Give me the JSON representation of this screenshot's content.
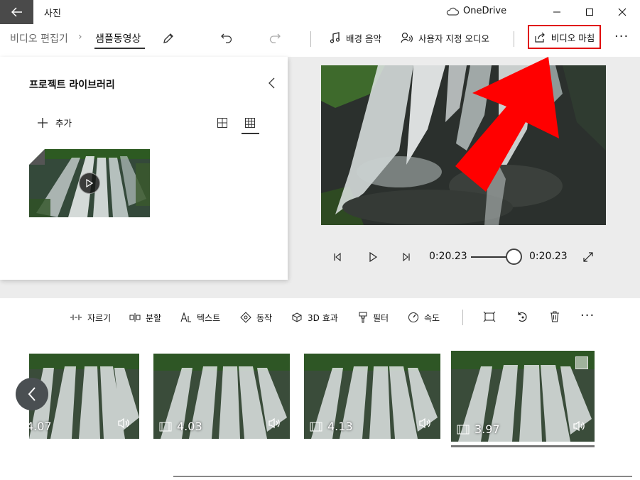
{
  "window": {
    "app_title": "사진",
    "cloud_label": "OneDrive"
  },
  "breadcrumb": {
    "root": "비디오 편집기",
    "current": "샘플동영상"
  },
  "toolbar": {
    "background_music": "배경 음악",
    "custom_audio": "사용자 지정 오디오",
    "finish_video": "비디오 마침"
  },
  "library": {
    "title": "프로젝트 라이브러리",
    "add_label": "추가"
  },
  "player": {
    "current_time": "0:20.23",
    "total_time": "0:20.23",
    "progress": 1.0
  },
  "storyboard": {
    "tools": [
      {
        "label": "자르기",
        "icon": "trim-icon"
      },
      {
        "label": "분할",
        "icon": "split-icon"
      },
      {
        "label": "텍스트",
        "icon": "text-icon"
      },
      {
        "label": "동작",
        "icon": "motion-icon"
      },
      {
        "label": "3D 효과",
        "icon": "3d-effects-icon"
      },
      {
        "label": "필터",
        "icon": "filter-icon"
      },
      {
        "label": "속도",
        "icon": "speed-icon"
      }
    ],
    "clips": [
      {
        "duration": "4.07"
      },
      {
        "duration": "4.03"
      },
      {
        "duration": "4.13"
      },
      {
        "duration": "3.97"
      }
    ]
  },
  "colors": {
    "highlight": "#e00000",
    "arrow": "#ff0000",
    "titlebar_back": "#4a4a4a"
  }
}
